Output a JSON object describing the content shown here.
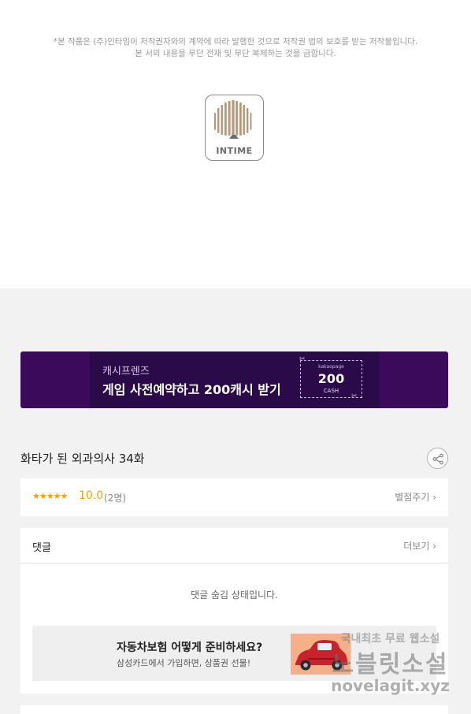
{
  "copyright": {
    "line1": "*본 작품은 (주)인타임이 저작권자와의 계약에 따라 발행한 것으로 저작권 법의 보호를 받는 저작물입니다.",
    "line2": "본 서의 내용을 무단 전재 및 무단 복제하는 것을 금합니다."
  },
  "publisher_logo": {
    "text": "INTIME",
    "icon": "intime-logo-icon"
  },
  "banner": {
    "subtitle": "캐시프렌즈",
    "title": "게임 사전예약하고 200캐시 받기",
    "coupon": {
      "brand": "kakaopage",
      "amount": "200",
      "unit": "CASH"
    },
    "colors": {
      "background": "#3b0a5a",
      "inner": "#2a0a48"
    }
  },
  "episode": {
    "title": "화타가 된 외과의사 34화",
    "share_icon": "share-icon"
  },
  "rating": {
    "stars": "★★★★★",
    "score": "10.0",
    "count": "(2명)",
    "rate_link": "별점주기 ›",
    "accent_color": "#f5a200"
  },
  "comments": {
    "title": "댓글",
    "more_link": "더보기 ›",
    "status": "댓글 숨김 상태입니다."
  },
  "ad": {
    "headline": "자동차보험 어떻게 준비하세요?",
    "description": "삼성카드에서 가입하면, 상품권 선물!",
    "image_icon": "red-car-icon"
  },
  "watermark": {
    "line1": "국내최초 무료 웹소설",
    "line2": "노블릿소설",
    "line3": "novelagit.xyz"
  }
}
